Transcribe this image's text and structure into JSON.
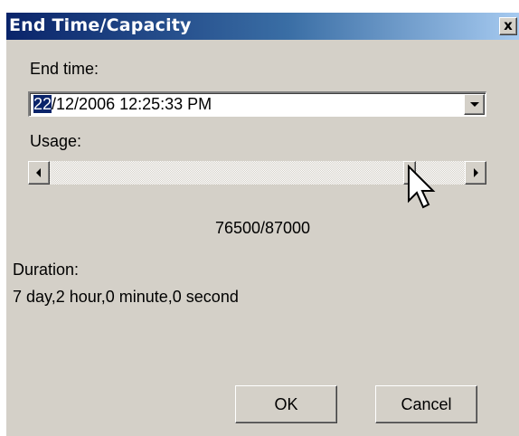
{
  "window": {
    "title": "End Time/Capacity",
    "close_glyph": "x"
  },
  "end_time": {
    "label": "End time:",
    "value_selected": "22",
    "value_rest": "/12/2006 12:25:33 PM"
  },
  "usage": {
    "label": "Usage:",
    "value_text": "76500/87000",
    "current": 76500,
    "max": 87000
  },
  "duration": {
    "label": "Duration:",
    "value": "7 day,2 hour,0 minute,0 second"
  },
  "buttons": {
    "ok_label": "OK",
    "cancel_label": "Cancel"
  },
  "icons": {
    "close": "close-icon",
    "dropdown": "chevron-down-icon",
    "scroll_left": "arrow-left-icon",
    "scroll_right": "arrow-right-icon",
    "cursor": "mouse-pointer-icon"
  },
  "colors": {
    "title_start": "#0a246a",
    "title_end": "#a6caf0",
    "face": "#d4d0c8",
    "selection": "#0a246a"
  }
}
